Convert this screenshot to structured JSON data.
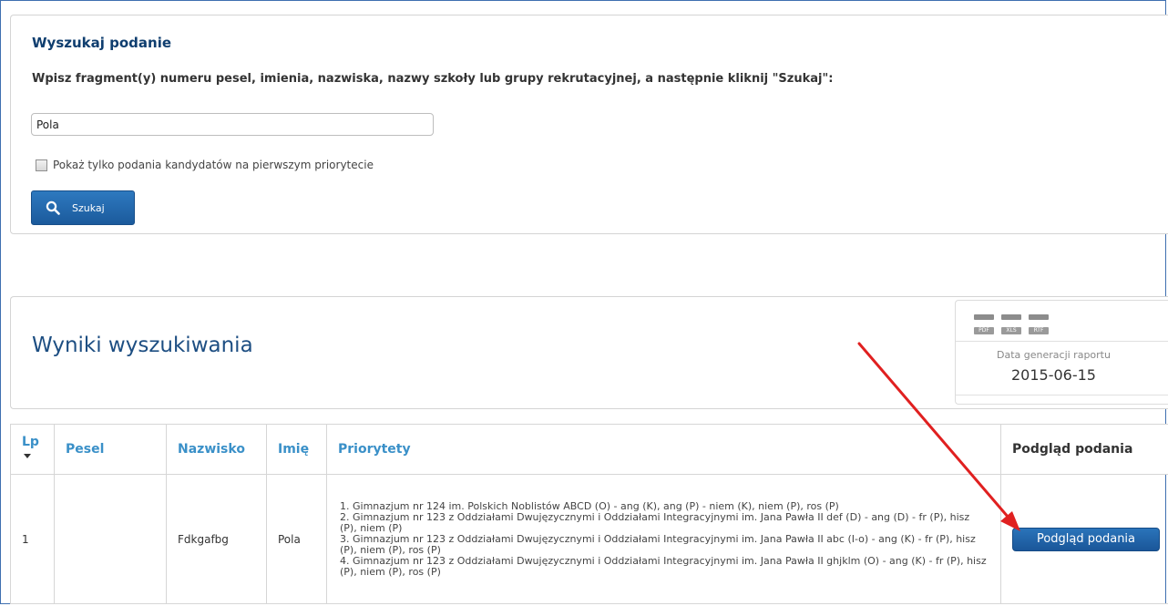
{
  "search": {
    "title": "Wyszukaj podanie",
    "instruction": "Wpisz fragment(y) numeru pesel, imienia, nazwiska, nazwy szkoły lub grupy rekrutacyjnej, a następnie kliknij \"Szukaj\":",
    "query_value": "Pola",
    "first_priority_only_label": "Pokaż tylko podania kandydatów na pierwszym priorytecie",
    "first_priority_only_checked": false,
    "button_label": "Szukaj"
  },
  "results": {
    "title": "Wyniki wyszukiwania",
    "export_formats": [
      "PDF",
      "XLS",
      "RTF"
    ],
    "report_date_label": "Data generacji raportu",
    "report_date": "2015-06-15",
    "columns": {
      "lp": "Lp",
      "pesel": "Pesel",
      "nazwisko": "Nazwisko",
      "imie": "Imię",
      "priorytety": "Priorytety",
      "podglad": "Podgląd podania"
    },
    "rows": [
      {
        "lp": "1",
        "pesel": "",
        "nazwisko": "Fdkgafbg",
        "imie": "Pola",
        "priorytety": [
          "1. Gimnazjum nr 124 im. Polskich Noblistów ABCD (O) - ang (K), ang (P) - niem (K), niem (P), ros (P)",
          "2. Gimnazjum nr 123 z Oddziałami Dwujęzycznymi i Oddziałami Integracyjnymi im. Jana Pawła II def (D) - ang (D) - fr (P), hisz (P), niem (P)",
          "3. Gimnazjum nr 123 z Oddziałami Dwujęzycznymi i Oddziałami Integracyjnymi im. Jana Pawła II abc (I-o) - ang (K) - fr (P), hisz (P), niem (P), ros (P)",
          "4. Gimnazjum nr 123 z Oddziałami Dwujęzycznymi i Oddziałami Integracyjnymi im. Jana Pawła II ghjklm (O) - ang (K) - fr (P), hisz (P), niem (P), ros (P)"
        ],
        "preview_button": "Podgląd podania"
      }
    ]
  },
  "colors": {
    "primary_button": "#1f63a8",
    "heading": "#0f3e6f",
    "column_header": "#3a90c8",
    "annotation_arrow": "#e02020"
  },
  "icons": [
    "search-icon",
    "sort-desc-icon",
    "pdf-icon",
    "xls-icon",
    "rtf-icon"
  ]
}
